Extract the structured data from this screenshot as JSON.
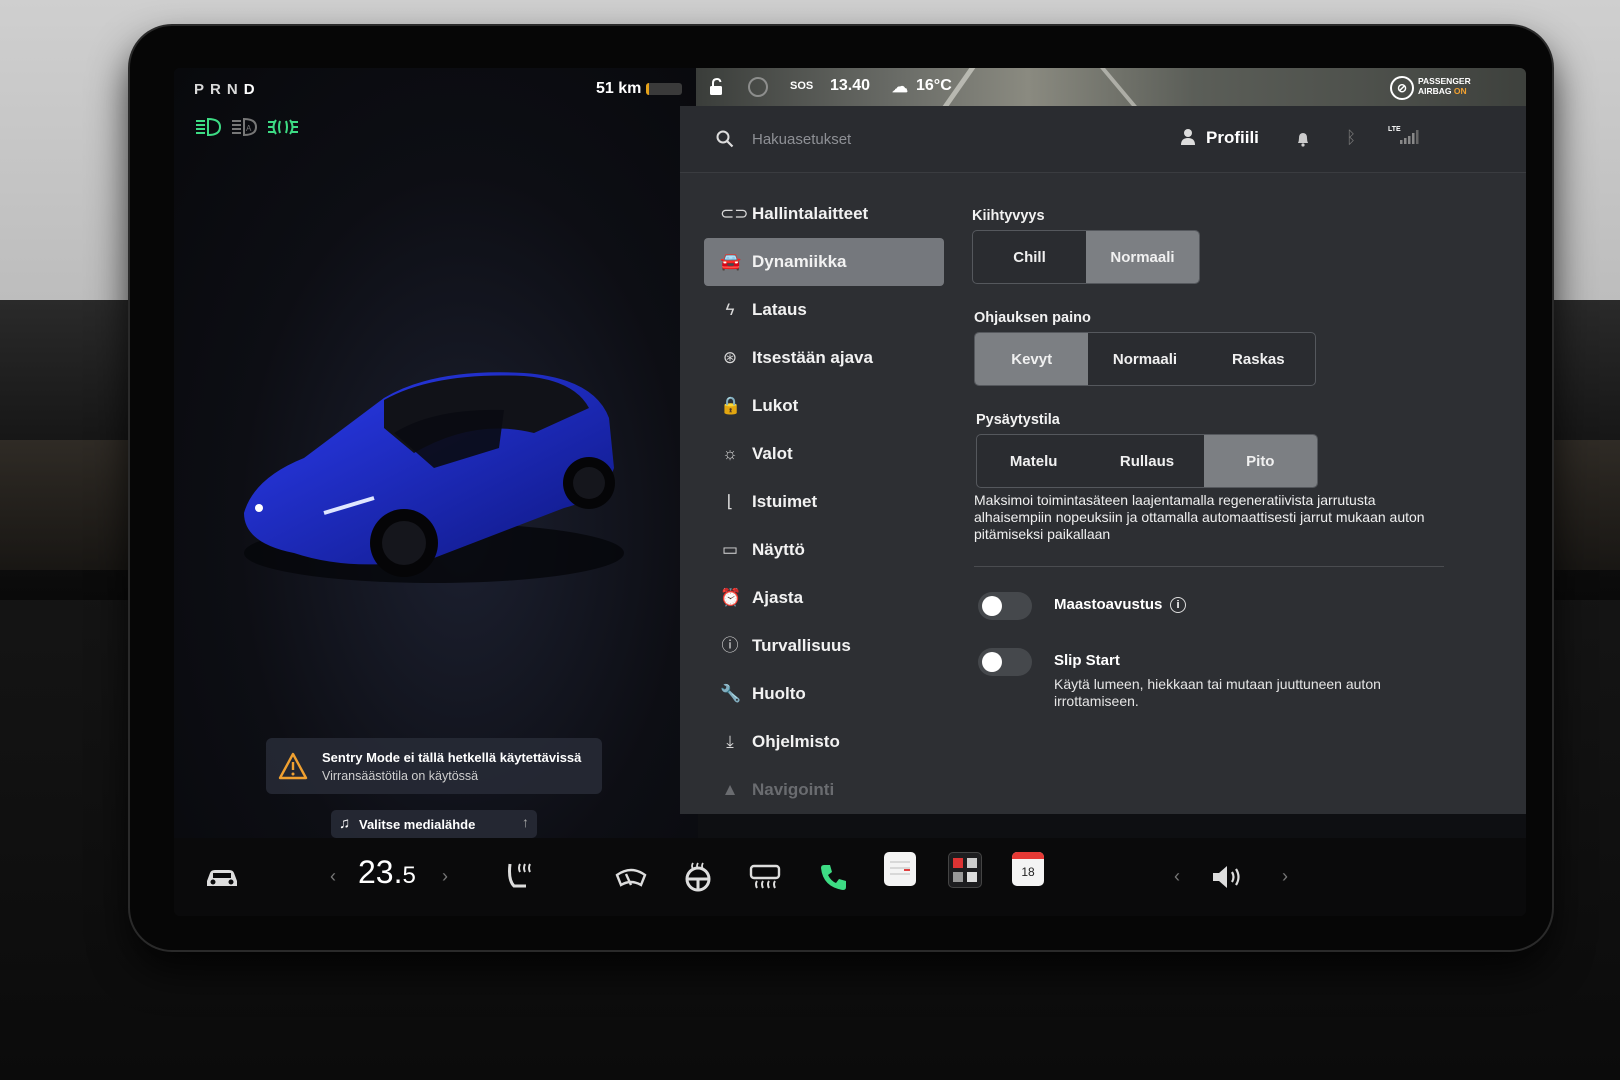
{
  "status_bar": {
    "gear": [
      "P",
      "R",
      "N",
      "D"
    ],
    "range": "51 km",
    "battery_level": 0.08,
    "sos": "SOS",
    "time": "13.40",
    "temperature": "16°C",
    "airbag_line1": "PASSENGER",
    "airbag_line2": "AIRBAG",
    "airbag_status": "ON"
  },
  "car_panel": {
    "alert_title": "Sentry Mode ei tällä hetkellä käytettävissä",
    "alert_subtitle": "Virransäästötila on käytössä",
    "media_button": "Valitse medialähde"
  },
  "topbar": {
    "search_placeholder": "Hakuasetukset",
    "profile_label": "Profiili",
    "lte": "LTE"
  },
  "nav": {
    "items": [
      {
        "label": "Hallintalaitteet",
        "icon": "toggle-icon"
      },
      {
        "label": "Dynamiikka",
        "icon": "car-icon"
      },
      {
        "label": "Lataus",
        "icon": "bolt-icon"
      },
      {
        "label": "Itsestään ajava",
        "icon": "steering-wheel-icon"
      },
      {
        "label": "Lukot",
        "icon": "lock-icon"
      },
      {
        "label": "Valot",
        "icon": "sun-icon"
      },
      {
        "label": "Istuimet",
        "icon": "seat-icon"
      },
      {
        "label": "Näyttö",
        "icon": "display-icon"
      },
      {
        "label": "Ajasta",
        "icon": "alarm-clock-icon"
      },
      {
        "label": "Turvallisuus",
        "icon": "alert-circle-icon"
      },
      {
        "label": "Huolto",
        "icon": "wrench-icon"
      },
      {
        "label": "Ohjelmisto",
        "icon": "download-icon"
      },
      {
        "label": "Navigointi",
        "icon": "navigation-icon"
      }
    ],
    "active_index": 1
  },
  "dynamics": {
    "acceleration": {
      "label": "Kiihtyvyys",
      "options": [
        "Chill",
        "Normaali"
      ],
      "selected": "Normaali"
    },
    "steering": {
      "label": "Ohjauksen paino",
      "options": [
        "Kevyt",
        "Normaali",
        "Raskas"
      ],
      "selected": "Kevyt"
    },
    "stopping": {
      "label": "Pysäytystila",
      "options": [
        "Matelu",
        "Rullaus",
        "Pito"
      ],
      "selected": "Pito"
    },
    "stopping_description": "Maksimoi toimintasäteen laajentamalla regeneratiivista jarrutusta alhaisempiin nopeuksiin ja ottamalla automaattisesti jarrut mukaan auton pitämiseksi paikallaan",
    "offroad": {
      "label": "Maastoavustus",
      "enabled": false
    },
    "slip_start": {
      "label": "Slip Start",
      "enabled": false,
      "description": "Käytä lumeen, hiekkaan tai mutaan juuttuneen auton irrottamiseen."
    }
  },
  "dock": {
    "temp_main": "23.",
    "temp_decimal": "5",
    "calendar_day": "18"
  },
  "colors": {
    "accent_green": "#3ddc84",
    "selected_segment": "#7c7f83",
    "car_blue": "#1f2fd0"
  }
}
